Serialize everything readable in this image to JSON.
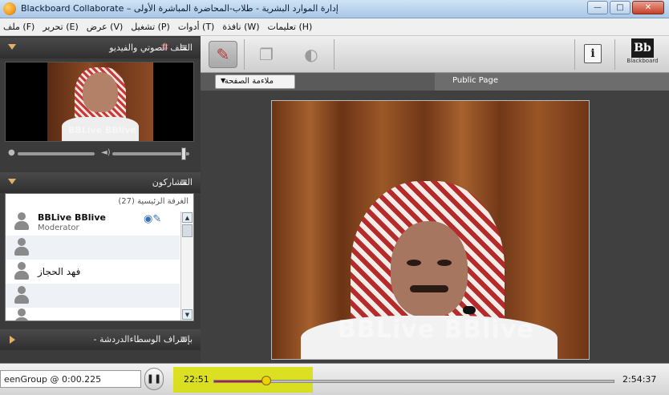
{
  "window": {
    "title": "Blackboard Collaborate – إدارة الموارد البشرية - طلاب-المحاضرة المباشرة الأولى",
    "controls": {
      "minimize": "—",
      "maximize": "□",
      "close": "✕"
    }
  },
  "menu": {
    "items": [
      "ملف (F)",
      "تحرير (E)",
      "عرض (V)",
      "تشغيل (P)",
      "أدوات (T)",
      "نافذة (W)",
      "تعليمات (H)"
    ]
  },
  "av_panel": {
    "title": "الملف الصوتي والفيديو",
    "video_watermark": "BBLive BBlive",
    "mic_level": 0.85,
    "speaker_level": 0.9
  },
  "participants_panel": {
    "title": "المشاركون",
    "room_label": "(27) الغرفة الرئيسية",
    "participants": [
      {
        "name": "BBLive BBlive",
        "role": "Moderator"
      },
      {
        "name": "",
        "role": ""
      },
      {
        "name": "فهد الحجاز",
        "role": ""
      },
      {
        "name": "",
        "role": ""
      },
      {
        "name": "",
        "role": ""
      }
    ]
  },
  "chat_panel": {
    "title": "- بإشراف الوسطاءالدردشة"
  },
  "toolbar": {
    "info_label": "i",
    "logo_mark": "Bb",
    "logo_text": "Blackboard"
  },
  "whiteboard": {
    "fit_label": "ملاءمة الصفحة",
    "page_tab": "Public Page",
    "watermark": "BBLive BBlive"
  },
  "player": {
    "recording_name": "eenGroup @ 0:00.225",
    "current_time": "22:51",
    "total_time": "2:54:37",
    "progress": 0.131
  },
  "colors": {
    "accent_red": "#b52020",
    "highlight_yellow": "#d8de00",
    "panel_dark": "#3b3b3b"
  }
}
